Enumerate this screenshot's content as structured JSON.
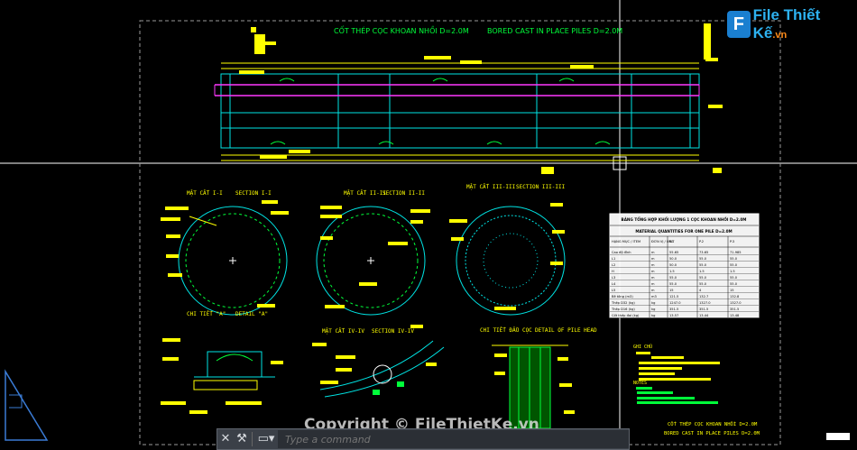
{
  "drawing": {
    "main_title_vn": "CỐT THÉP CỌC KHOAN NHỒI D=2.0M",
    "main_title_en": "BORED CAST IN PLACE PILES D=2.0M",
    "section_labels": [
      {
        "vn": "MẶT CẮT I-I",
        "en": "SECTION I-I"
      },
      {
        "vn": "MẶT CẮT II-II",
        "en": "SECTION II-II"
      },
      {
        "vn": "MẶT CẮT III-III",
        "en": "SECTION III-III"
      }
    ],
    "detail_a": {
      "vn": "CHI TIẾT \"A\"",
      "en": "DETAIL \"A\""
    },
    "section_iv": {
      "vn": "MẶT CẮT IV-IV",
      "en": "SECTION IV-IV"
    },
    "pile_head": {
      "vn": "CHI TIẾT ĐẦU CỌC",
      "en": "DETAIL OF PILE HEAD"
    },
    "bottom_title_vn": "CỐT THÉP CỌC KHOAN NHỒI D=2.0M",
    "bottom_title_en": "BORED CAST IN PLACE PILES D=2.0M"
  },
  "table": {
    "title_vn": "BẢNG TỔNG HỢP KHỐI LƯỢNG 1 CỌC KHOAN NHỒI D=2.0M",
    "title_en": "MATERIAL QUANTITIES FOR ONE PILE D=2.0M",
    "headers": [
      "HẠNG MỤC / ITEM",
      "ĐƠN VỊ / UNIT",
      "P.1",
      "P.2",
      "P.3"
    ],
    "rows": [
      [
        "Cao độ đỉnh",
        "m",
        "55.65",
        "73.65",
        "71.985"
      ],
      [
        "L1",
        "m",
        "50.0",
        "55.0",
        "55.0"
      ],
      [
        "L2",
        "m",
        "50.0",
        "55.0",
        "55.0"
      ],
      [
        "H",
        "m",
        "1.5",
        "1.5",
        "1.5"
      ],
      [
        "L3",
        "m",
        "55.0",
        "55.0",
        "55.0"
      ],
      [
        "L4",
        "m",
        "55.0",
        "55.0",
        "55.0"
      ],
      [
        "L5",
        "m",
        "15",
        "4",
        "15"
      ],
      [
        "Bê tông (m3)",
        "m3",
        "121.5",
        "132.7",
        "132.8"
      ],
      [
        "Thép D32 (kg)",
        "kg",
        "1247.0",
        "1327.0",
        "1327.0"
      ],
      [
        "Thép D16 (kg)",
        "kg",
        "351.5",
        "351.5",
        "351.5"
      ],
      [
        "Cốt thép đai (kg)",
        "kg",
        "13.57",
        "13.44",
        "13.48"
      ]
    ]
  },
  "notes": {
    "title": "GHI CHÚ",
    "notes_label": "NOTES"
  },
  "command_line": {
    "placeholder": "Type a command"
  },
  "watermark": "Copyright © FileThietKe.vn",
  "logo": {
    "letter": "F",
    "text": "File Thiết Kế",
    "suffix": ".vn"
  },
  "colors": {
    "background": "#000000",
    "cyan": "#00e5e5",
    "yellow": "#ffff00",
    "green": "#00ff3a",
    "magenta": "#ff38ff"
  }
}
